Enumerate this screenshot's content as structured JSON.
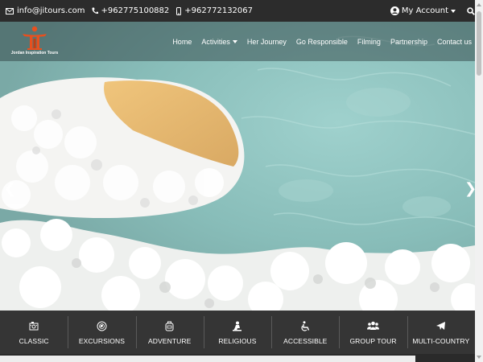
{
  "topbar": {
    "email": "info@jitours.com",
    "phone1": "+962775100882",
    "phone2": "+962772132067",
    "account_label": "My Account"
  },
  "logo": {
    "text": "Jordan Inspiration Tours"
  },
  "nav": {
    "items": [
      {
        "label": "Home"
      },
      {
        "label": "Activities",
        "has_dropdown": true
      },
      {
        "label": "Her Journey"
      },
      {
        "label": "Go Responsible"
      },
      {
        "label": "Filming"
      },
      {
        "label": "Partnership"
      },
      {
        "label": "Contact us"
      }
    ]
  },
  "hero": {
    "prev_arrow": "❮",
    "next_arrow": "❯"
  },
  "categories": [
    {
      "label": "CLASSIC",
      "icon": "camera-icon"
    },
    {
      "label": "EXCURSIONS",
      "icon": "compass-icon"
    },
    {
      "label": "ADVENTURE",
      "icon": "backpack-icon"
    },
    {
      "label": "RELIGIOUS",
      "icon": "praying-icon"
    },
    {
      "label": "ACCESSIBLE",
      "icon": "wheelchair-icon"
    },
    {
      "label": "GROUP TOUR",
      "icon": "group-icon"
    },
    {
      "label": "MULTI-COUNTRY",
      "icon": "plane-icon"
    }
  ],
  "colors": {
    "bar": "#353535",
    "topbar": "#2c2c2c",
    "logo_accent": "#e8501e"
  }
}
